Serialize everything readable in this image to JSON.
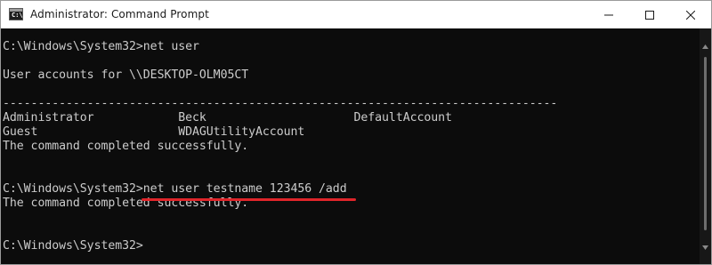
{
  "window": {
    "title": "Administrator: Command Prompt",
    "icon_text": "C:\\",
    "controls": [
      "minimize-icon",
      "maximize-icon",
      "close-icon"
    ]
  },
  "console": {
    "lines": [
      "C:\\Windows\\System32>net user",
      "",
      "User accounts for \\\\DESKTOP-OLM05CT",
      "",
      "-------------------------------------------------------------------------------",
      "Administrator            Beck                     DefaultAccount",
      "Guest                    WDAGUtilityAccount",
      "The command completed successfully.",
      "",
      "",
      "C:\\Windows\\System32>net user testname 123456 /add",
      "The command completed successfully.",
      "",
      "",
      "C:\\Windows\\System32>"
    ]
  },
  "annotation": {
    "color": "#e0252a"
  },
  "colors": {
    "console_bg": "#0c0c0c",
    "console_text": "#cccccc"
  }
}
